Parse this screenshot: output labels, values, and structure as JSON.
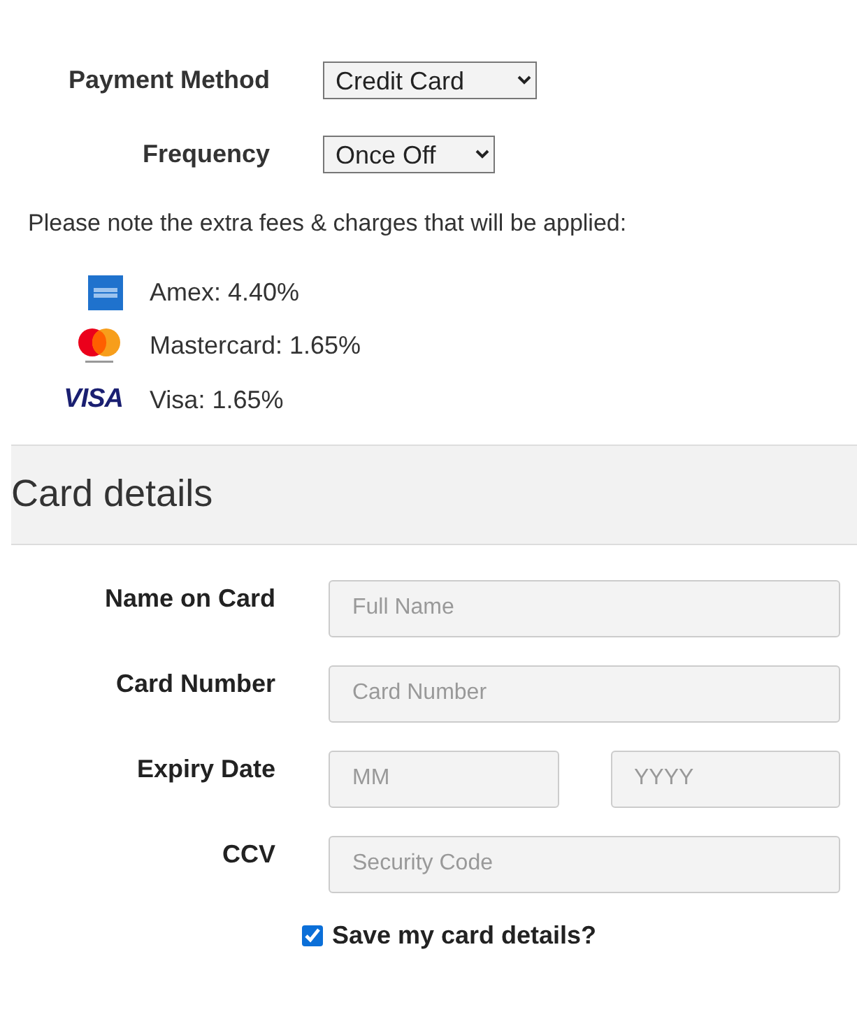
{
  "payment_method": {
    "label": "Payment Method",
    "value": "Credit Card"
  },
  "frequency": {
    "label": "Frequency",
    "value": "Once Off"
  },
  "fees_note": "Please note the extra fees & charges that will be applied:",
  "fees": [
    {
      "kind": "amex",
      "text": "Amex: 4.40%"
    },
    {
      "kind": "mastercard",
      "text": "Mastercard: 1.65%"
    },
    {
      "kind": "visa",
      "logo_text": "VISA",
      "text": "Visa: 1.65%"
    }
  ],
  "card_details": {
    "title": "Card details",
    "fields": [
      {
        "label": "Name on Card",
        "inputs": [
          {
            "placeholder": "Full Name"
          }
        ]
      },
      {
        "label": "Card Number",
        "inputs": [
          {
            "placeholder": "Card Number"
          }
        ]
      },
      {
        "label": "Expiry Date",
        "inputs": [
          {
            "placeholder": "MM"
          },
          {
            "placeholder": "YYYY"
          }
        ]
      },
      {
        "label": "CCV",
        "inputs": [
          {
            "placeholder": "Security Code"
          }
        ]
      }
    ],
    "save_card": {
      "label": "Save my card details?",
      "checked": true
    }
  }
}
